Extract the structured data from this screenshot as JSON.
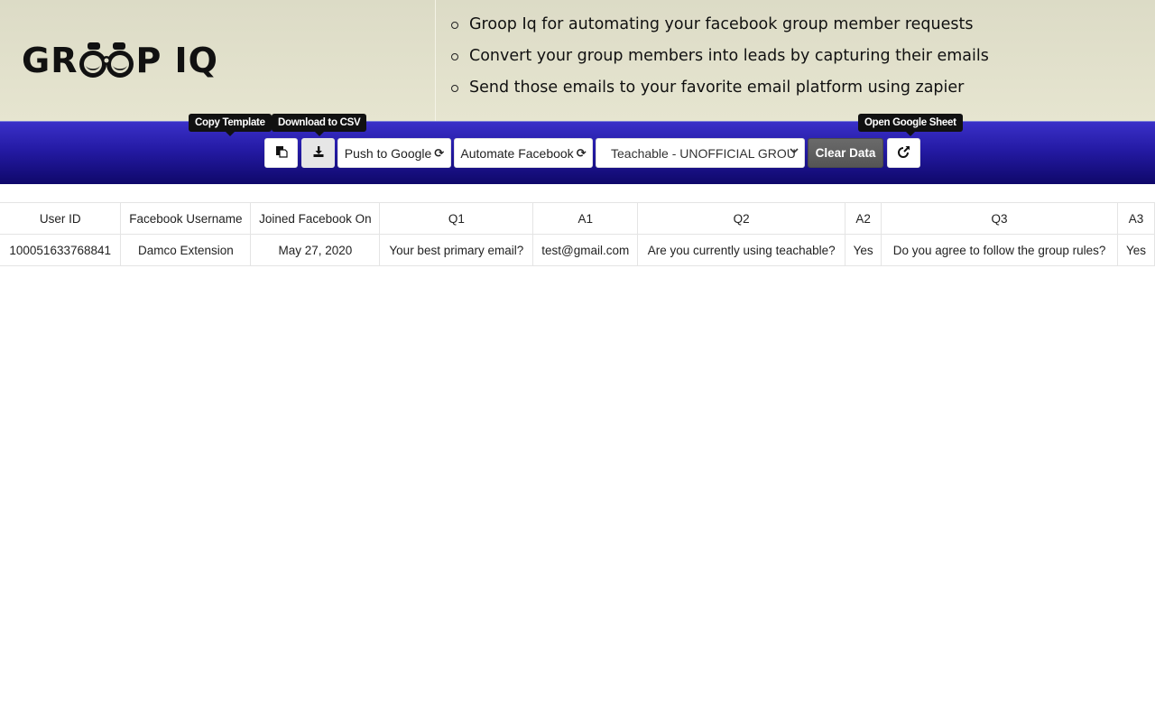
{
  "header": {
    "logo_text_left": "GR",
    "logo_text_right": "P IQ",
    "features": [
      "Groop Iq for automating your facebook group member requests",
      "Convert your group members into leads by capturing their emails",
      "Send those emails to your favorite email platform using zapier"
    ]
  },
  "toolbar": {
    "tooltips": {
      "copy_template": "Copy Template",
      "download_csv": "Download to CSV",
      "open_sheet": "Open Google Sheet"
    },
    "push_google_label": "Push to Google",
    "automate_facebook_label": "Automate Facebook",
    "refresh_glyph": "⟳",
    "group_select_value": "Teachable - UNOFFICIAL GROU",
    "clear_data_label": "Clear Data"
  },
  "table": {
    "columns": [
      "User ID",
      "Facebook Username",
      "Joined Facebook On",
      "Q1",
      "A1",
      "Q2",
      "A2",
      "Q3",
      "A3"
    ],
    "rows": [
      [
        "100051633768841",
        "Damco Extension",
        "May 27, 2020",
        "Your best primary email?",
        "test@gmail.com",
        "Are you currently using teachable?",
        "Yes",
        "Do you agree to follow the group rules?",
        "Yes"
      ]
    ]
  },
  "colors": {
    "hero_bg": "#e0dfca",
    "toolbar_top": "#3a30c8",
    "toolbar_bottom": "#0f086a",
    "clear_btn": "#5e5e5e"
  }
}
